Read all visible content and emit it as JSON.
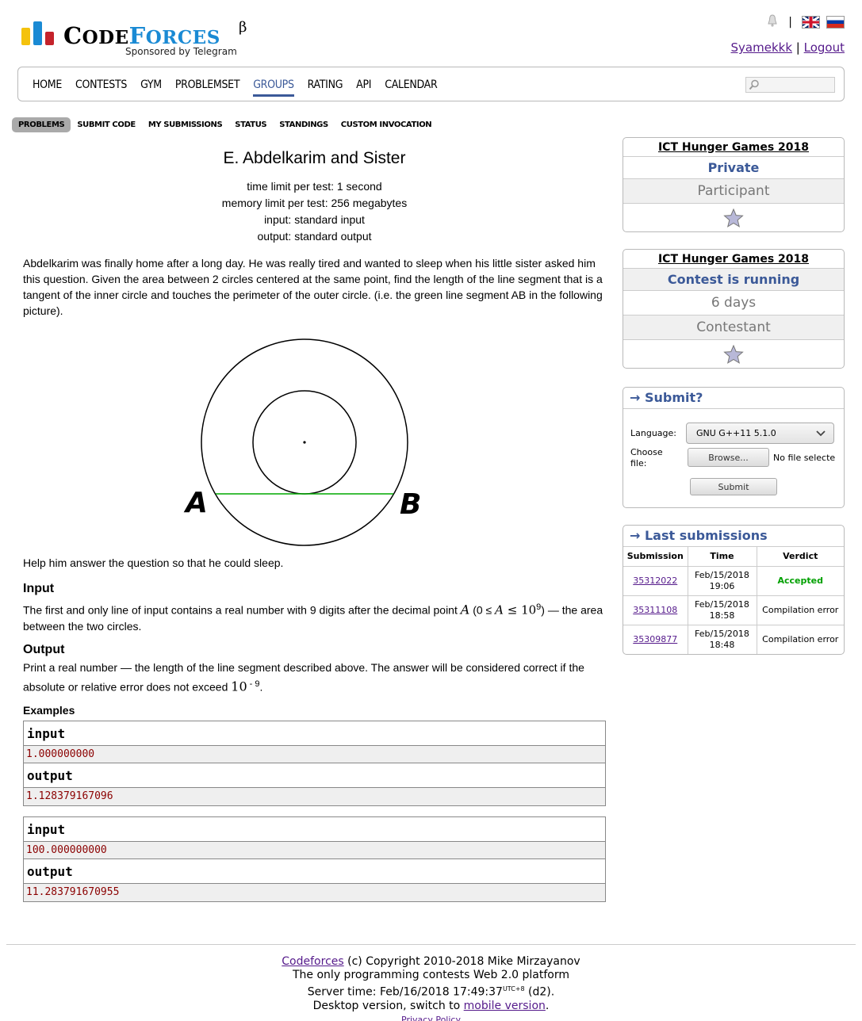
{
  "header": {
    "logo_main": "CODEFORCES",
    "logo_beta": "β",
    "sponsor": "Sponsored by Telegram",
    "separator": "|",
    "username": "Syamekkk",
    "logout": "Logout",
    "link_sep": "|"
  },
  "menu": {
    "items": [
      "HOME",
      "CONTESTS",
      "GYM",
      "PROBLEMSET",
      "GROUPS",
      "RATING",
      "API",
      "CALENDAR"
    ],
    "current": "GROUPS"
  },
  "submenu": {
    "items": [
      "PROBLEMS",
      "SUBMIT CODE",
      "MY SUBMISSIONS",
      "STATUS",
      "STANDINGS",
      "CUSTOM INVOCATION"
    ],
    "current": "PROBLEMS"
  },
  "problem": {
    "title": "E. Abdelkarim and Sister",
    "time_limit": "time limit per test: 1 second",
    "memory_limit": "memory limit per test: 256 megabytes",
    "input": "input: standard input",
    "output": "output: standard output",
    "legend": "Abdelkarim was finally home after a long day. He was really tired and wanted to sleep when his little sister asked him this question. Given the area between 2 circles centered at the same point, find the length of the line segment that is a tangent of the inner circle and touches the perimeter of the outer circle. (i.e. the green line segment AB in the following picture).",
    "figure_label_a": "A",
    "figure_label_b": "B",
    "help_text": "Help him answer the question so that he could sleep.",
    "input_title": "Input",
    "input_text_1": "The first and only line of input contains a real number with 9 digits after the decimal point ",
    "input_var": "A",
    "input_bound_open": " (0 ≤ ",
    "input_bound_mid": "A",
    "input_bound_le": " ≤ 10",
    "input_bound_exp": "9",
    "input_bound_close": ")",
    "input_text_2": " — the area between the two circles.",
    "output_title": "Output",
    "output_text": "Print a real number — the length of the line segment described above. The answer will be considered correct if the absolute or relative error does not exceed ",
    "output_base": "10",
    "output_exp": " - 9",
    "output_end": ".",
    "examples_title": "Examples",
    "examples": [
      {
        "input_label": "input",
        "input": "1.000000000",
        "output_label": "output",
        "output": "1.128379167096"
      },
      {
        "input_label": "input",
        "input": "100.000000000",
        "output_label": "output",
        "output": "11.283791670955"
      }
    ]
  },
  "sidebar": {
    "box1": {
      "name": "ICT Hunger Games 2018",
      "type": "Private",
      "role": "Participant"
    },
    "box2": {
      "name": "ICT Hunger Games 2018",
      "status": "Contest is running",
      "remaining": "6 days",
      "role": "Contestant"
    },
    "submit": {
      "title": "→ Submit?",
      "language_label": "Language:",
      "language_value": "GNU G++11 5.1.0",
      "file_label": "Choose file:",
      "browse": "Browse...",
      "no_file": "No file selecte",
      "submit": "Submit"
    },
    "last": {
      "title": "→ Last submissions",
      "headers": [
        "Submission",
        "Time",
        "Verdict"
      ],
      "rows": [
        {
          "id": "35312022",
          "time": "Feb/15/2018 19:06",
          "verdict": "Accepted",
          "ok": true
        },
        {
          "id": "35311108",
          "time": "Feb/15/2018 18:58",
          "verdict": "Compilation error",
          "ok": false
        },
        {
          "id": "35309877",
          "time": "Feb/15/2018 18:48",
          "verdict": "Compilation error",
          "ok": false
        }
      ]
    }
  },
  "footer": {
    "brand": "Codeforces",
    "copyright": " (c) Copyright 2010-2018 Mike Mirzayanov",
    "tagline": "The only programming contests Web 2.0 platform",
    "server_time": "Server time: Feb/16/2018 17:49:37",
    "tz": "UTC+8",
    "instance": " (d2).",
    "desktop": "Desktop version, switch to ",
    "mobile": "mobile version",
    "period": ".",
    "privacy": "Privacy Policy"
  },
  "colors": {
    "brand_blue": "#3b5998",
    "accepted": "#00a000",
    "logo_yellow": "#f4c20d",
    "logo_blue": "#1a8ad4",
    "logo_red": "#c4232b",
    "sample_text": "#8b0000",
    "tangent_green": "#00aa00"
  }
}
